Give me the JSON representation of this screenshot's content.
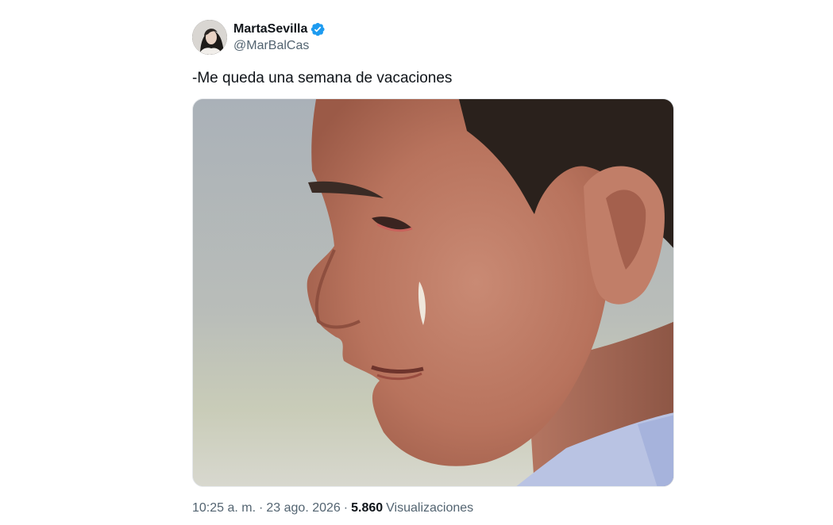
{
  "tweet": {
    "author": {
      "display_name": "MartaSevilla",
      "handle": "@MarBalCas",
      "verified": true,
      "verified_color": "#1d9bf0"
    },
    "text": "-Me queda una semana de vacaciones",
    "media": {
      "icon": "photo-icon"
    },
    "meta": {
      "time": "10:25 a. m.",
      "separator": "·",
      "date": "23 ago. 2026",
      "views_count": "5.860",
      "views_label": "Visualizaciones"
    }
  }
}
